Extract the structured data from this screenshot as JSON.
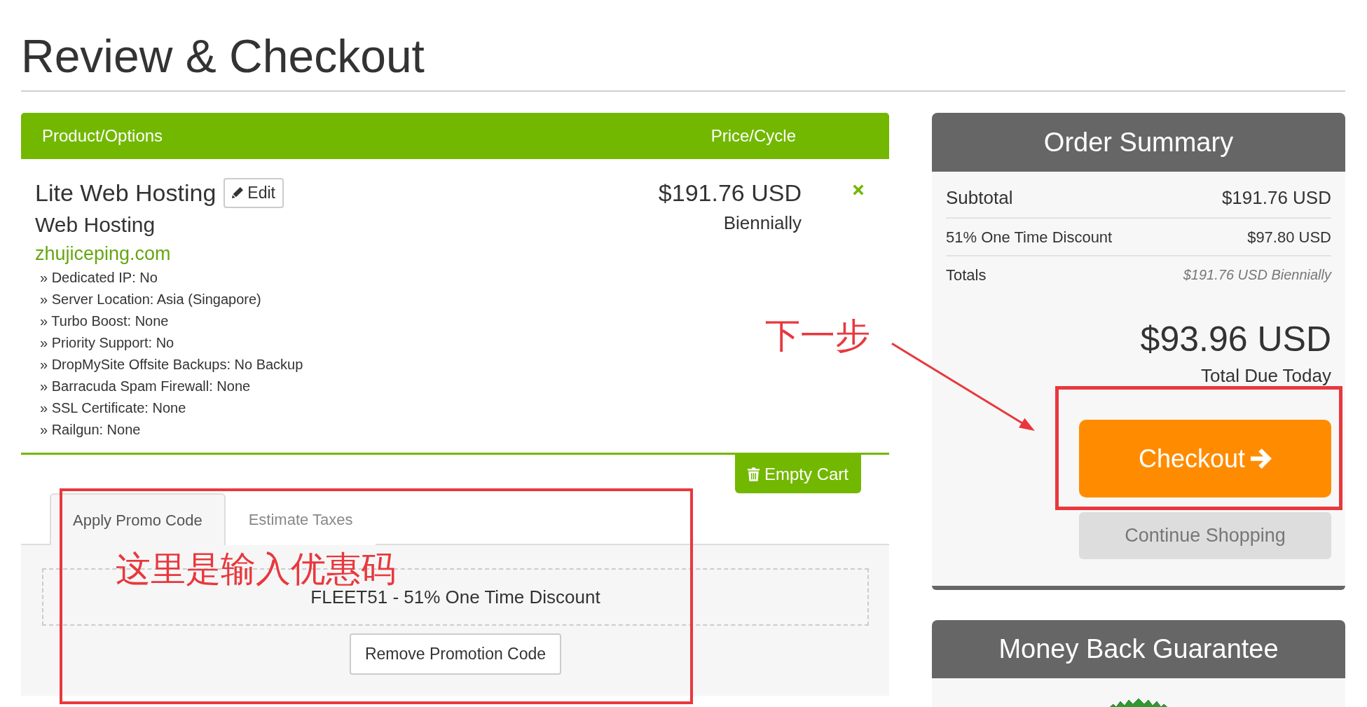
{
  "page_title": "Review & Checkout",
  "cart": {
    "columns": [
      {
        "label": "Product/Options"
      },
      {
        "label": "Price/Cycle"
      }
    ],
    "items": [
      {
        "name": "Lite Web Hosting",
        "edit_button": "Edit",
        "group": "Web Hosting",
        "domain": "zhujiceping.com",
        "options": [
          "» Dedicated IP: No",
          "» Server Location: Asia (Singapore)",
          "» Turbo Boost: None",
          "» Priority Support: No",
          "» DropMySite Offsite Backups: No Backup",
          "» Barracuda Spam Firewall: None",
          "» SSL Certificate: None",
          "» Railgun: None"
        ],
        "price": "$191.76 USD",
        "cycle": "Biennially"
      }
    ],
    "empty_cart_button": "Empty Cart"
  },
  "promo_tabs": [
    {
      "label": "Apply Promo Code",
      "selected": true
    },
    {
      "label": "Estimate Taxes",
      "selected": false
    }
  ],
  "promo": {
    "applied_code": "FLEET51 - 51% One Time Discount",
    "remove_button": "Remove Promotion Code"
  },
  "order_summary": {
    "title": "Order Summary",
    "rows": [
      {
        "kind": "subtotal",
        "label": "Subtotal",
        "value": "$191.76 USD"
      },
      {
        "kind": "discount",
        "label": "51% One Time Discount",
        "value": "$97.80 USD"
      },
      {
        "kind": "totals",
        "label": "Totals",
        "value": "$191.76 USD Biennially"
      }
    ],
    "total_due": "$93.96 USD",
    "total_due_label": "Total Due Today",
    "checkout_button": "Checkout",
    "continue_button": "Continue Shopping"
  },
  "money_back": {
    "title": "Money Back Guarantee"
  },
  "annotations": [
    {
      "kind": "promo-note",
      "text": "这里是输入优惠码"
    },
    {
      "kind": "next-step",
      "text": "下一步"
    }
  ]
}
